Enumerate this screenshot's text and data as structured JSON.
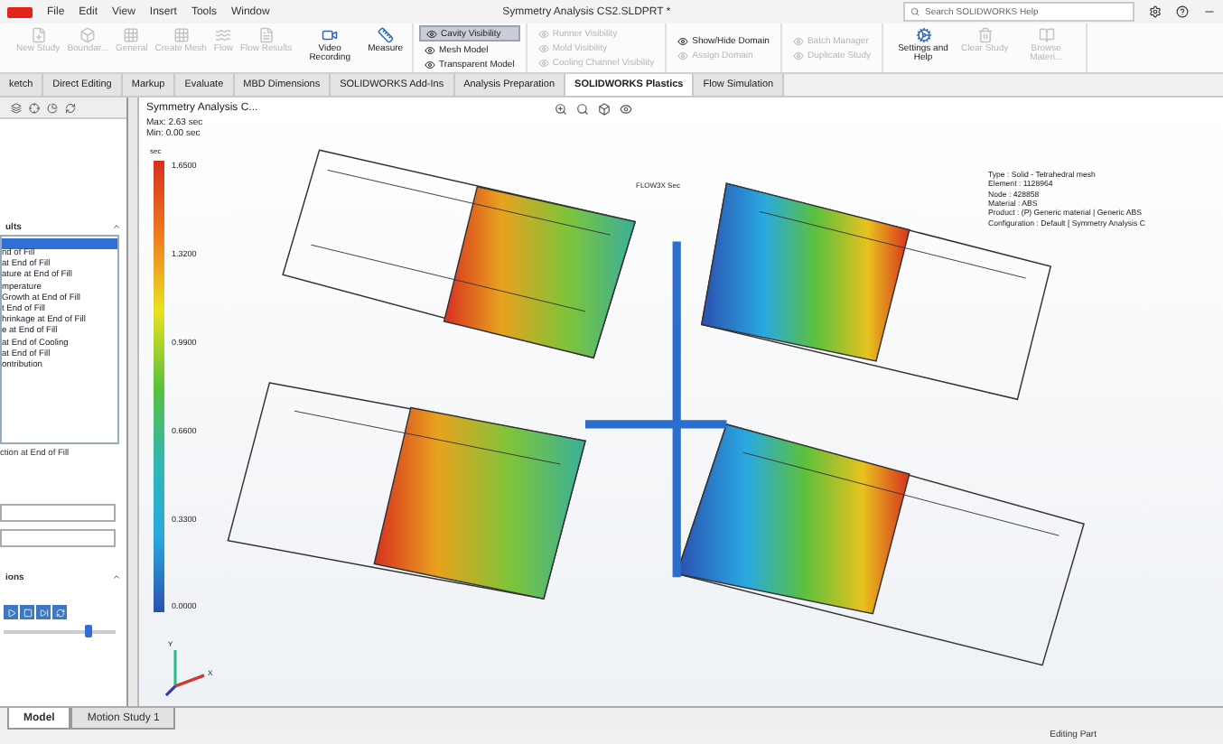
{
  "menu": [
    "File",
    "Edit",
    "View",
    "Insert",
    "Tools",
    "Window"
  ],
  "title": "Symmetry Analysis CS2.SLDPRT *",
  "search": {
    "placeholder": "Search SOLIDWORKS Help"
  },
  "ribbon": [
    {
      "kind": "large",
      "items": [
        {
          "label": "New Study",
          "disabled": true
        },
        {
          "label": "Boundar...",
          "disabled": true
        },
        {
          "label": "General",
          "disabled": true
        },
        {
          "label": "Create Mesh",
          "disabled": true
        },
        {
          "label": "Flow",
          "disabled": true
        },
        {
          "label": "Flow Results",
          "disabled": true
        },
        {
          "label": "Video Recording",
          "disabled": false
        },
        {
          "label": "Measure",
          "disabled": false
        }
      ]
    },
    {
      "kind": "stack",
      "items": [
        {
          "label": "Cavity Visibility",
          "disabled": false,
          "selected": true
        },
        {
          "label": "Mesh Model",
          "disabled": false,
          "selected": false
        },
        {
          "label": "Transparent Model",
          "disabled": false,
          "selected": false
        }
      ]
    },
    {
      "kind": "stack",
      "items": [
        {
          "label": "Runner Visibility",
          "disabled": true,
          "selected": false
        },
        {
          "label": "Mold Visibility",
          "disabled": true,
          "selected": false
        },
        {
          "label": "Cooling Channel Visibility",
          "disabled": true,
          "selected": false
        }
      ]
    },
    {
      "kind": "stack",
      "items": [
        {
          "label": "Show/Hide Domain",
          "disabled": false,
          "selected": false
        },
        {
          "label": "Assign Domain",
          "disabled": true,
          "selected": false
        }
      ]
    },
    {
      "kind": "stack",
      "items": [
        {
          "label": "Batch Manager",
          "disabled": true,
          "selected": false
        },
        {
          "label": "Duplicate Study",
          "disabled": true,
          "selected": false
        }
      ]
    },
    {
      "kind": "large",
      "items": [
        {
          "label": "Settings and Help",
          "disabled": false
        },
        {
          "label": "Clear Study",
          "disabled": true
        },
        {
          "label": "Browse Materi...",
          "disabled": true
        }
      ]
    }
  ],
  "tabs": [
    {
      "label": "ketch",
      "selected": false
    },
    {
      "label": "Direct Editing",
      "selected": false
    },
    {
      "label": "Markup",
      "selected": false
    },
    {
      "label": "Evaluate",
      "selected": false
    },
    {
      "label": "MBD Dimensions",
      "selected": false
    },
    {
      "label": "SOLIDWORKS Add-Ins",
      "selected": false
    },
    {
      "label": "Analysis Preparation",
      "selected": false
    },
    {
      "label": "SOLIDWORKS Plastics",
      "selected": true
    },
    {
      "label": "Flow Simulation",
      "selected": false
    }
  ],
  "left_panel": {
    "results_heading": "ults",
    "results": [
      {
        "label": "nd of Fill",
        "selected": false
      },
      {
        "label": "at End of Fill",
        "selected": false
      },
      {
        "label": "ature at End of Fill",
        "selected": false
      },
      {
        "label": "mperature",
        "selected": false
      },
      {
        "label": "Growth at End of Fill",
        "selected": false
      },
      {
        "label": "t End of Fill",
        "selected": false
      },
      {
        "label": "hrinkage at End of Fill",
        "selected": false
      },
      {
        "label": "e at End of Fill",
        "selected": false
      },
      {
        "label": "at End of Cooling",
        "selected": false
      },
      {
        "label": "at End of Fill",
        "selected": false
      },
      {
        "label": "ontribution",
        "selected": false
      }
    ],
    "below_list": "ction at End of Fill",
    "options_heading": "ions",
    "slider": {
      "level": 0.75
    }
  },
  "viewport": {
    "study": "Symmetry Analysis C...",
    "max": "Max: 2.63 sec",
    "min": "Min: 0.00 sec",
    "model_label": "FLOW3X Sec",
    "legend": {
      "unit": "sec",
      "ticks": [
        "1.6500",
        "1.3200",
        "0.9900",
        "0.6600",
        "0.3300",
        "0.0000"
      ]
    },
    "info": [
      "Type : Solid - Tetrahedral mesh",
      "Element : 1128964",
      "Node : 428858",
      "Material : ABS",
      "Product : (P) Generic material | Generic ABS",
      "Configuration : Default [ Symmetry Analysis C"
    ],
    "triad": [
      "Y",
      "X"
    ]
  },
  "bottom_tabs": [
    {
      "label": "Model",
      "selected": true
    },
    {
      "label": "Motion Study 1",
      "selected": false
    }
  ],
  "status": "Editing Part"
}
